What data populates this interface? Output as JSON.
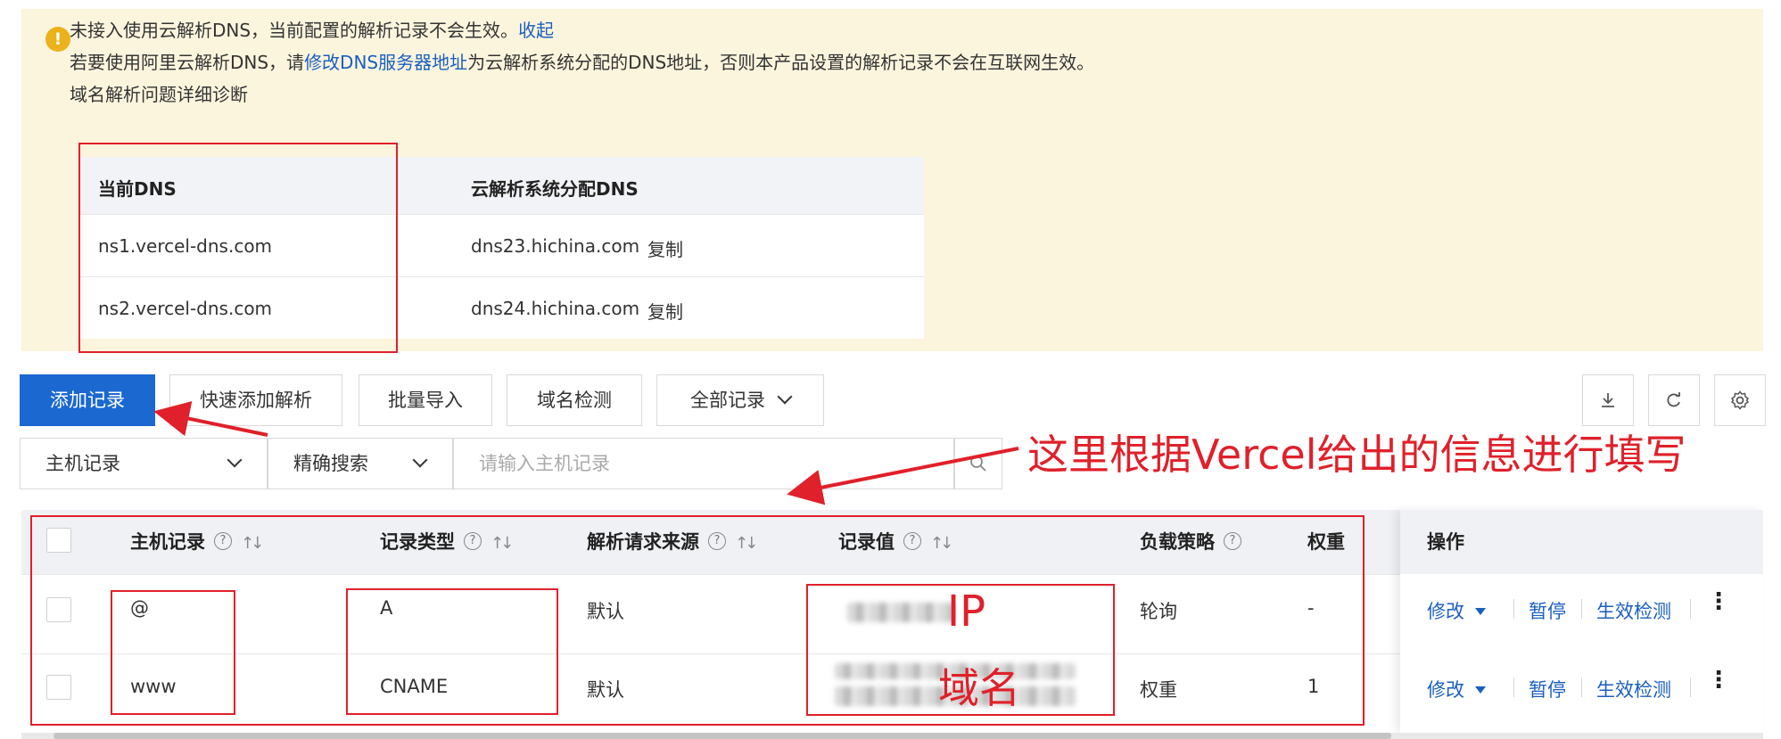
{
  "notice": {
    "line1_text": "未接入使用云解析DNS，当前配置的解析记录不会生效。",
    "line1_link": "收起",
    "line2_prefix": "若要使用阿里云解析DNS，请",
    "line2_link": "修改DNS服务器地址",
    "line2_suffix": "为云解析系统分配的DNS地址，否则本产品设置的解析记录不会在互联网生效。",
    "diagnose_link": "域名解析问题详细诊断",
    "dns_table": {
      "col_current": "当前DNS",
      "col_assigned": "云解析系统分配DNS",
      "copy_label": "复制",
      "rows": [
        {
          "current": "ns1.vercel-dns.com",
          "assigned": "dns23.hichina.com"
        },
        {
          "current": "ns2.vercel-dns.com",
          "assigned": "dns24.hichina.com"
        }
      ]
    }
  },
  "toolbar": {
    "add_record": "添加记录",
    "quick_add": "快速添加解析",
    "batch_import": "批量导入",
    "domain_check": "域名检测",
    "all_records": "全部记录",
    "icons": [
      "download-icon",
      "refresh-icon",
      "settings-icon"
    ]
  },
  "search": {
    "field_select": "主机记录",
    "mode_select": "精确搜索",
    "placeholder": "请输入主机记录"
  },
  "table": {
    "columns": {
      "host": "主机记录",
      "type": "记录类型",
      "source": "解析请求来源",
      "value": "记录值",
      "strategy": "负载策略",
      "weight": "权重",
      "actions": "操作"
    },
    "rows": [
      {
        "host": "@",
        "type": "A",
        "source": "默认",
        "strategy": "轮询",
        "weight": "-"
      },
      {
        "host": "www",
        "type": "CNAME",
        "source": "默认",
        "strategy": "权重",
        "weight": "1"
      }
    ],
    "action_labels": {
      "edit": "修改",
      "pause": "暂停",
      "check": "生效检测"
    }
  },
  "annotations": {
    "main_text": "这里根据Vercel给出的信息进行填写",
    "ip_label": "IP",
    "domain_label": "域名",
    "color": "#e0202a"
  },
  "colors": {
    "notice_bg": "#fcf5dd",
    "primary": "#1b68d1",
    "link": "#1a5fbf",
    "warning": "#ebb21b"
  }
}
